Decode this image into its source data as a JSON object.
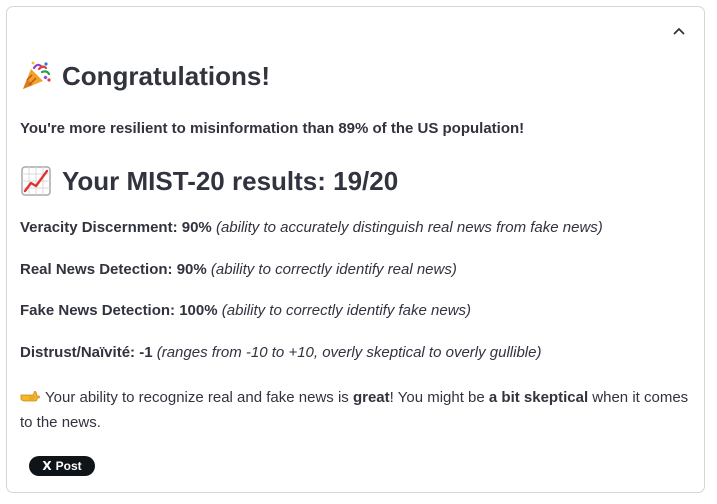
{
  "header": {
    "collapse_icon": "chevron-up-icon"
  },
  "congrats": {
    "icon": "party-popper-icon",
    "title": "Congratulations!",
    "message": "You're more resilient to misinformation than 89% of the US population!"
  },
  "results": {
    "icon": "chart-increasing-icon",
    "title": "Your MIST-20 results: 19/20",
    "metrics": [
      {
        "label": "Veracity Discernment:",
        "value": "90%",
        "description": "(ability to accurately distinguish real news from fake news)"
      },
      {
        "label": "Real News Detection:",
        "value": "90%",
        "description": "(ability to correctly identify real news)"
      },
      {
        "label": "Fake News Detection:",
        "value": "100%",
        "description": "(ability to correctly identify fake news)"
      },
      {
        "label": "Distrust/Naïvité:",
        "value": "-1",
        "description": "(ranges from -10 to +10, overly skeptical to overly gullible)"
      }
    ]
  },
  "summary": {
    "icon": "backhand-index-pointing-right-icon",
    "part1": "Your ability to recognize real and fake news is ",
    "bold1": "great",
    "part2": "! You might be ",
    "bold2": "a bit skeptical",
    "part3": " when it comes to the news."
  },
  "share": {
    "logo": "X",
    "label": "Post"
  }
}
